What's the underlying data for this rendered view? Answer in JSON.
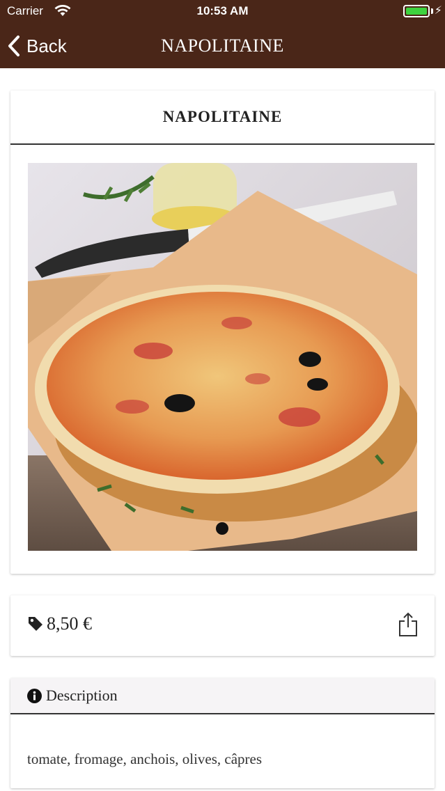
{
  "status_bar": {
    "carrier": "Carrier",
    "time": "10:53 AM",
    "battery_level": 1.0
  },
  "nav": {
    "back_label": "Back",
    "title": "NAPOLITAINE"
  },
  "product": {
    "title": "NAPOLITAINE",
    "image_alt": "pizza-photo",
    "carousel": {
      "pages": 1,
      "current": 1
    }
  },
  "price": {
    "amount": "8,50 €",
    "tag_icon": "tag-icon",
    "share_icon": "share-icon"
  },
  "description": {
    "heading": "Description",
    "icon": "info-icon",
    "text": "tomate, fromage, anchois, olives, câpres"
  },
  "colors": {
    "nav_bg": "#4a2618",
    "battery_fill": "#3ed23e",
    "card_header_bg": "#f6f4f6"
  }
}
